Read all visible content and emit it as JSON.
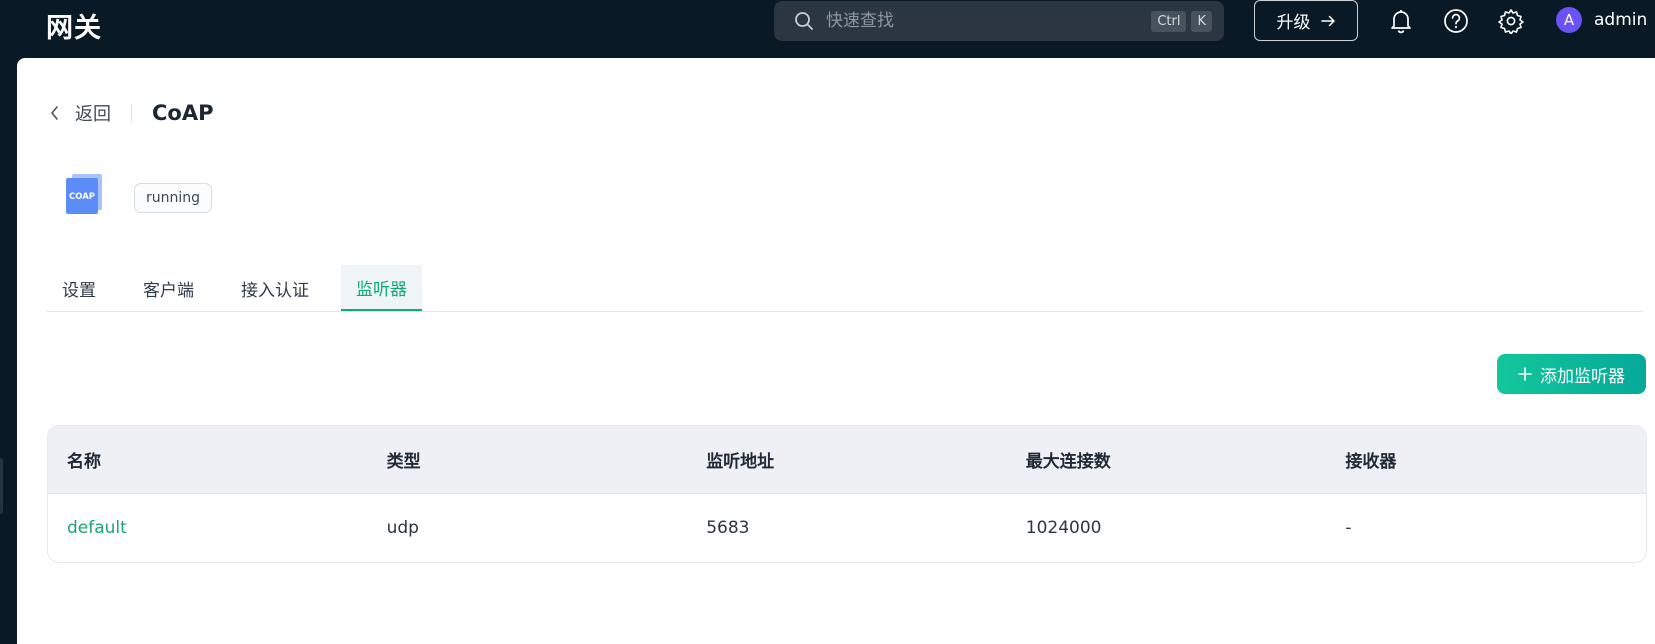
{
  "app": {
    "brand": "网关"
  },
  "topbar": {
    "search_placeholder": "快速查找",
    "shortcut_keys": [
      "Ctrl",
      "K"
    ],
    "upgrade_label": "升级",
    "icons": [
      "bell-icon",
      "help-icon",
      "gear-icon"
    ],
    "user": {
      "avatar_initial": "A",
      "name": "admin"
    }
  },
  "page": {
    "back_label": "返回",
    "title": "CoAP",
    "protocol_icon_text": "COAP",
    "status": "running"
  },
  "tabs": [
    {
      "label": "设置",
      "active": false
    },
    {
      "label": "客户端",
      "active": false
    },
    {
      "label": "接入认证",
      "active": false
    },
    {
      "label": "监听器",
      "active": true
    }
  ],
  "actions": {
    "add_listener_label": "添加监听器"
  },
  "table": {
    "columns": [
      "名称",
      "类型",
      "监听地址",
      "最大连接数",
      "接收器"
    ],
    "rows": [
      {
        "name": "default",
        "type": "udp",
        "address": "5683",
        "max_connections": "1024000",
        "acceptors": "-"
      }
    ]
  },
  "colors": {
    "topbar_bg": "#091a26",
    "accent_green": "#12a877",
    "avatar_purple": "#6b52f5",
    "protocol_icon_blue": "#5b8cf7"
  }
}
